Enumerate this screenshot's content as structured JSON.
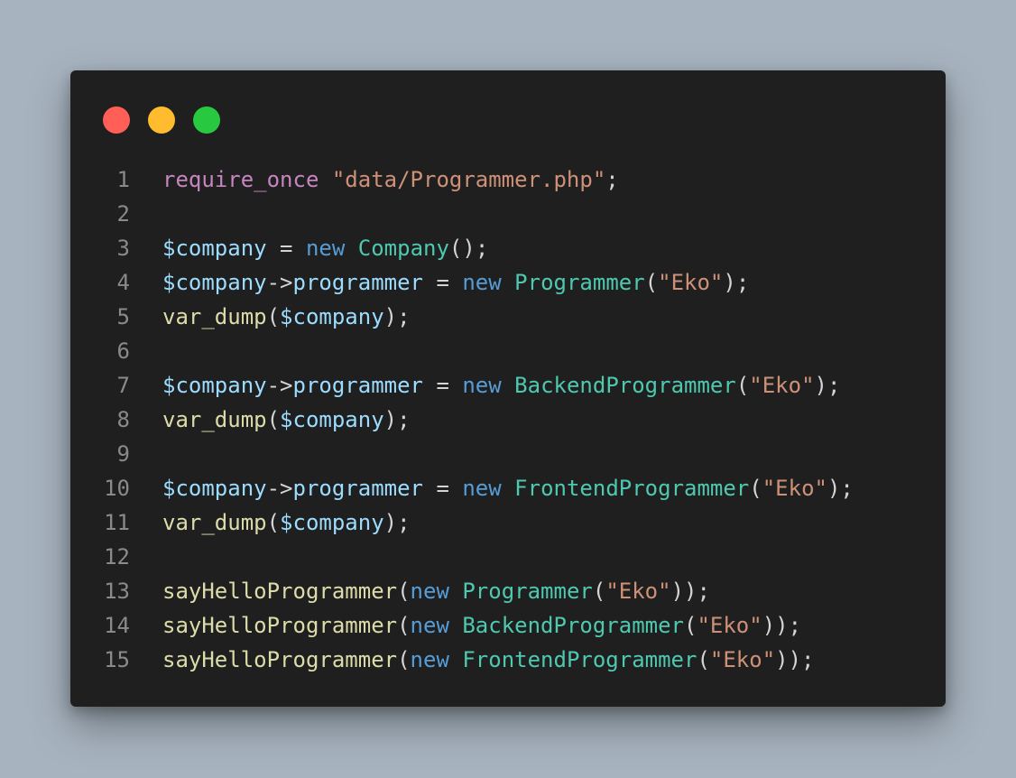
{
  "window": {
    "controls": [
      {
        "name": "close",
        "color": "#ff5f57"
      },
      {
        "name": "minimize",
        "color": "#febc2e"
      },
      {
        "name": "maximize",
        "color": "#28c840"
      }
    ]
  },
  "editor": {
    "language": "php",
    "lines": [
      {
        "number": "1",
        "tokens": [
          {
            "t": "kw-ctrl",
            "v": "require_once"
          },
          {
            "t": "pun",
            "v": " "
          },
          {
            "t": "str",
            "v": "\"data/Programmer.php\""
          },
          {
            "t": "pun",
            "v": ";"
          }
        ]
      },
      {
        "number": "2",
        "tokens": []
      },
      {
        "number": "3",
        "tokens": [
          {
            "t": "var",
            "v": "$company"
          },
          {
            "t": "pun",
            "v": " = "
          },
          {
            "t": "kw",
            "v": "new"
          },
          {
            "t": "pun",
            "v": " "
          },
          {
            "t": "cls",
            "v": "Company"
          },
          {
            "t": "pun",
            "v": "();"
          }
        ]
      },
      {
        "number": "4",
        "tokens": [
          {
            "t": "var",
            "v": "$company"
          },
          {
            "t": "pun",
            "v": "->"
          },
          {
            "t": "var",
            "v": "programmer"
          },
          {
            "t": "pun",
            "v": " = "
          },
          {
            "t": "kw",
            "v": "new"
          },
          {
            "t": "pun",
            "v": " "
          },
          {
            "t": "cls",
            "v": "Programmer"
          },
          {
            "t": "pun",
            "v": "("
          },
          {
            "t": "str",
            "v": "\"Eko\""
          },
          {
            "t": "pun",
            "v": ");"
          }
        ]
      },
      {
        "number": "5",
        "tokens": [
          {
            "t": "fn",
            "v": "var_dump"
          },
          {
            "t": "pun",
            "v": "("
          },
          {
            "t": "var",
            "v": "$company"
          },
          {
            "t": "pun",
            "v": ");"
          }
        ]
      },
      {
        "number": "6",
        "tokens": []
      },
      {
        "number": "7",
        "tokens": [
          {
            "t": "var",
            "v": "$company"
          },
          {
            "t": "pun",
            "v": "->"
          },
          {
            "t": "var",
            "v": "programmer"
          },
          {
            "t": "pun",
            "v": " = "
          },
          {
            "t": "kw",
            "v": "new"
          },
          {
            "t": "pun",
            "v": " "
          },
          {
            "t": "cls",
            "v": "BackendProgrammer"
          },
          {
            "t": "pun",
            "v": "("
          },
          {
            "t": "str",
            "v": "\"Eko\""
          },
          {
            "t": "pun",
            "v": ");"
          }
        ]
      },
      {
        "number": "8",
        "tokens": [
          {
            "t": "fn",
            "v": "var_dump"
          },
          {
            "t": "pun",
            "v": "("
          },
          {
            "t": "var",
            "v": "$company"
          },
          {
            "t": "pun",
            "v": ");"
          }
        ]
      },
      {
        "number": "9",
        "tokens": []
      },
      {
        "number": "10",
        "tokens": [
          {
            "t": "var",
            "v": "$company"
          },
          {
            "t": "pun",
            "v": "->"
          },
          {
            "t": "var",
            "v": "programmer"
          },
          {
            "t": "pun",
            "v": " = "
          },
          {
            "t": "kw",
            "v": "new"
          },
          {
            "t": "pun",
            "v": " "
          },
          {
            "t": "cls",
            "v": "FrontendProgrammer"
          },
          {
            "t": "pun",
            "v": "("
          },
          {
            "t": "str",
            "v": "\"Eko\""
          },
          {
            "t": "pun",
            "v": ");"
          }
        ]
      },
      {
        "number": "11",
        "tokens": [
          {
            "t": "fn",
            "v": "var_dump"
          },
          {
            "t": "pun",
            "v": "("
          },
          {
            "t": "var",
            "v": "$company"
          },
          {
            "t": "pun",
            "v": ");"
          }
        ]
      },
      {
        "number": "12",
        "tokens": []
      },
      {
        "number": "13",
        "tokens": [
          {
            "t": "fn",
            "v": "sayHelloProgrammer"
          },
          {
            "t": "pun",
            "v": "("
          },
          {
            "t": "kw",
            "v": "new"
          },
          {
            "t": "pun",
            "v": " "
          },
          {
            "t": "cls",
            "v": "Programmer"
          },
          {
            "t": "pun",
            "v": "("
          },
          {
            "t": "str",
            "v": "\"Eko\""
          },
          {
            "t": "pun",
            "v": "));"
          }
        ]
      },
      {
        "number": "14",
        "tokens": [
          {
            "t": "fn",
            "v": "sayHelloProgrammer"
          },
          {
            "t": "pun",
            "v": "("
          },
          {
            "t": "kw",
            "v": "new"
          },
          {
            "t": "pun",
            "v": " "
          },
          {
            "t": "cls",
            "v": "BackendProgrammer"
          },
          {
            "t": "pun",
            "v": "("
          },
          {
            "t": "str",
            "v": "\"Eko\""
          },
          {
            "t": "pun",
            "v": "));"
          }
        ]
      },
      {
        "number": "15",
        "tokens": [
          {
            "t": "fn",
            "v": "sayHelloProgrammer"
          },
          {
            "t": "pun",
            "v": "("
          },
          {
            "t": "kw",
            "v": "new"
          },
          {
            "t": "pun",
            "v": " "
          },
          {
            "t": "cls",
            "v": "FrontendProgrammer"
          },
          {
            "t": "pun",
            "v": "("
          },
          {
            "t": "str",
            "v": "\"Eko\""
          },
          {
            "t": "pun",
            "v": "));"
          }
        ]
      }
    ]
  }
}
